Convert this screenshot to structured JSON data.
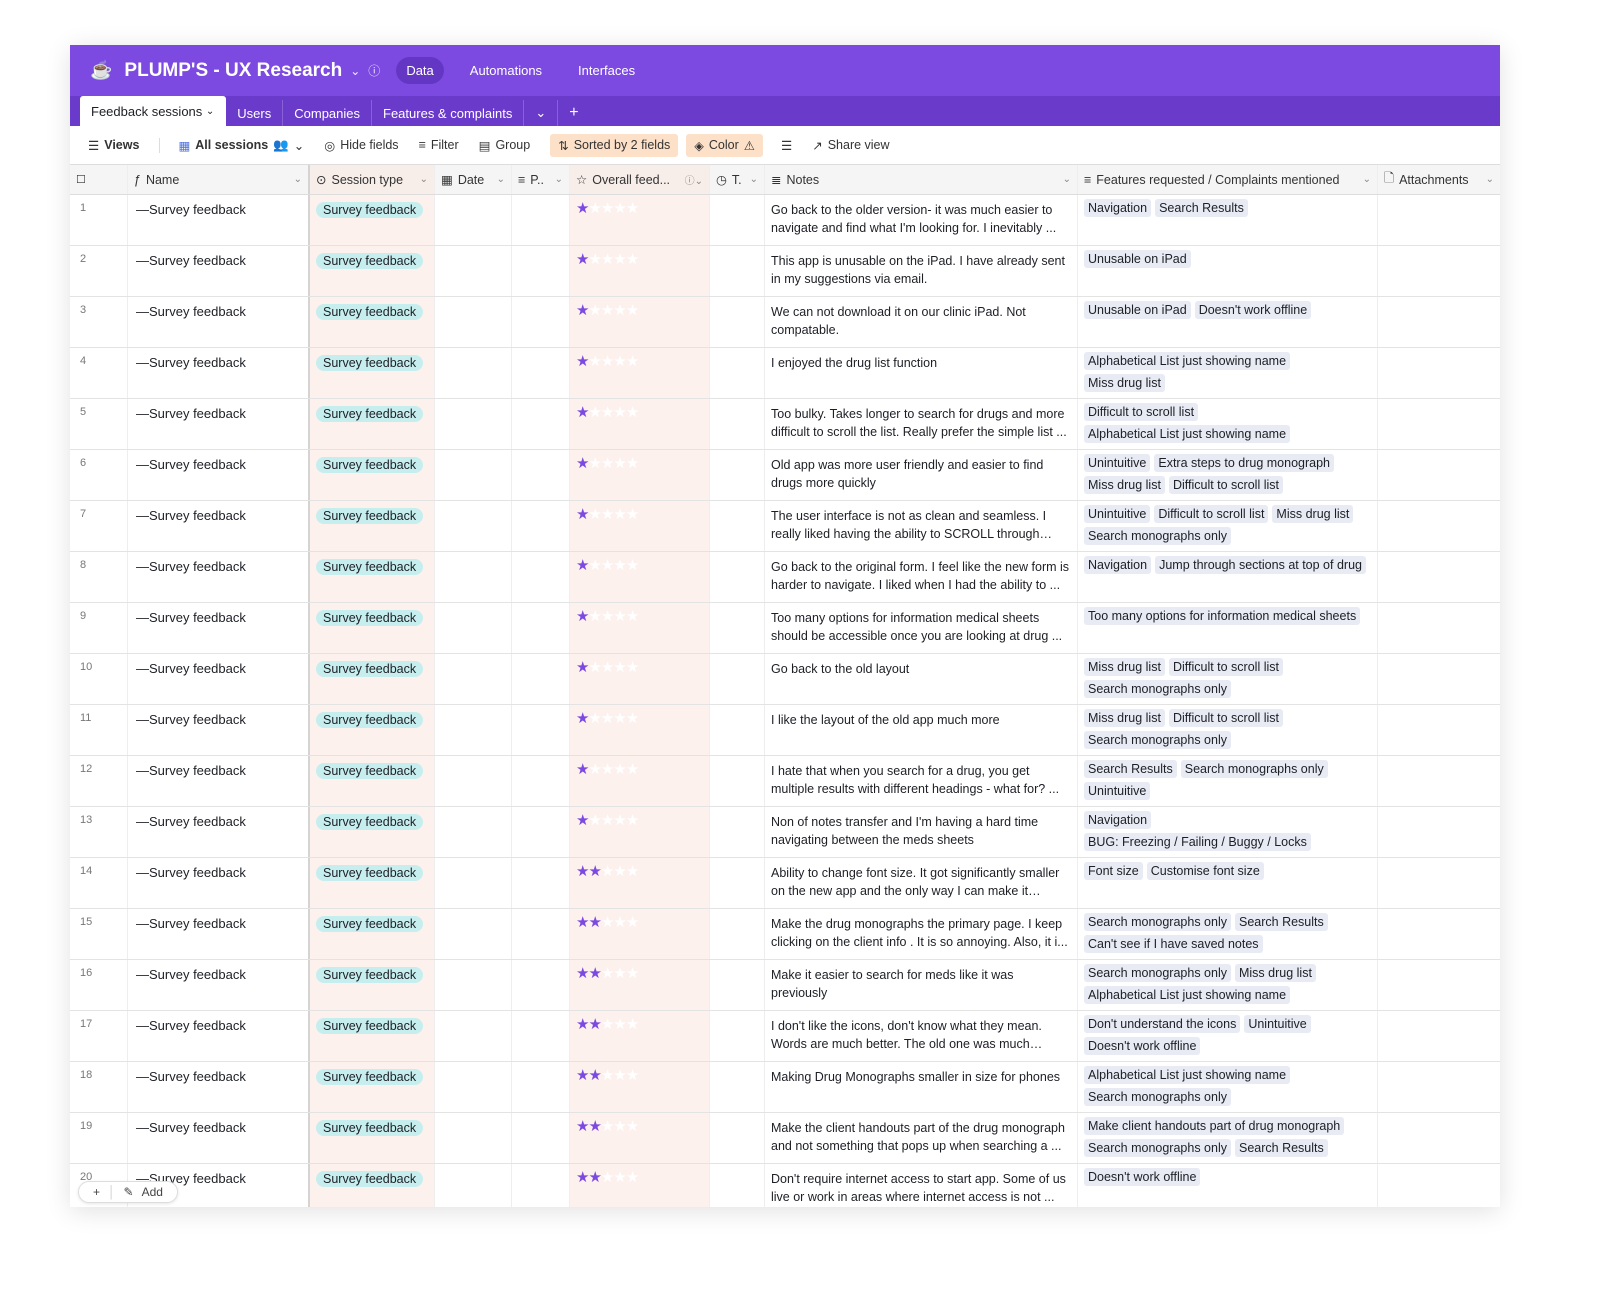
{
  "header": {
    "title": "PLUMP'S - UX Research",
    "nav": [
      "Data",
      "Automations",
      "Interfaces"
    ]
  },
  "tabs": [
    "Feedback sessions",
    "Users",
    "Companies",
    "Features & complaints"
  ],
  "toolbar": {
    "views": "Views",
    "view_name": "All sessions",
    "hide": "Hide fields",
    "filter": "Filter",
    "group": "Group",
    "sort": "Sorted by 2 fields",
    "color": "Color",
    "share": "Share view"
  },
  "columns": [
    "Name",
    "Session type",
    "Date",
    "P..",
    "Overall feed...",
    "T.",
    "Notes",
    "Features requested / Complaints mentioned",
    "Attachments"
  ],
  "footer": {
    "add": "Add"
  },
  "colors": {
    "accent": "#7c4ae0",
    "session_pill": "#c7eeee",
    "tag": "#e8ebf4"
  },
  "rows": [
    {
      "n": "1",
      "name": "—Survey feedback",
      "type": "Survey feedback",
      "rating": 1,
      "notes": "Go back to the older version- it was much easier to navigate and find what I'm looking for. I inevitably ...",
      "tags": [
        "Navigation",
        "Search Results"
      ]
    },
    {
      "n": "2",
      "name": "—Survey feedback",
      "type": "Survey feedback",
      "rating": 1,
      "notes": "This app is unusable on the iPad. I have already sent in my suggestions via email.",
      "tags": [
        "Unusable on iPad"
      ]
    },
    {
      "n": "3",
      "name": "—Survey feedback",
      "type": "Survey feedback",
      "rating": 1,
      "notes": "We can not download it on our clinic iPad. Not compatable.",
      "tags": [
        "Unusable on iPad",
        "Doesn't work offline"
      ]
    },
    {
      "n": "4",
      "name": "—Survey feedback",
      "type": "Survey feedback",
      "rating": 1,
      "notes": "I enjoyed the drug list function",
      "tags": [
        "Alphabetical List just showing name",
        "Miss drug list"
      ]
    },
    {
      "n": "5",
      "name": "—Survey feedback",
      "type": "Survey feedback",
      "rating": 1,
      "notes": "Too bulky. Takes longer to search for drugs and more difficult to scroll the list. Really prefer the simple list ...",
      "tags": [
        "Difficult to scroll list",
        "Alphabetical List just showing name"
      ]
    },
    {
      "n": "6",
      "name": "—Survey feedback",
      "type": "Survey feedback",
      "rating": 1,
      "notes": "Old app was more user friendly and easier to find drugs more quickly",
      "tags": [
        "Unintuitive",
        "Extra steps to drug monograph",
        "Miss drug list",
        "Difficult to scroll list"
      ]
    },
    {
      "n": "7",
      "name": "—Survey feedback",
      "type": "Survey feedback",
      "rating": 1,
      "notes": "The user interface is not as clean and seamless. I really liked having the ability to SCROLL through ALL...",
      "tags": [
        "Unintuitive",
        "Difficult to scroll list",
        "Miss drug list",
        "Search monographs only"
      ]
    },
    {
      "n": "8",
      "name": "—Survey feedback",
      "type": "Survey feedback",
      "rating": 1,
      "notes": "Go back to the original form. I feel like the new form is harder to navigate. I liked when I had the ability to ...",
      "tags": [
        "Navigation",
        "Jump through sections at top of drug"
      ]
    },
    {
      "n": "9",
      "name": "—Survey feedback",
      "type": "Survey feedback",
      "rating": 1,
      "notes": "Too many options for information medical sheets should be accessible once you are looking at drug ...",
      "tags": [
        "Too many options for information medical sheets"
      ]
    },
    {
      "n": "10",
      "name": "—Survey feedback",
      "type": "Survey feedback",
      "rating": 1,
      "notes": "Go back to the old layout",
      "tags": [
        "Miss drug list",
        "Difficult to scroll list",
        "Search monographs only"
      ]
    },
    {
      "n": "11",
      "name": "—Survey feedback",
      "type": "Survey feedback",
      "rating": 1,
      "notes": "I like the layout of the old app much more",
      "tags": [
        "Miss drug list",
        "Difficult to scroll list",
        "Search monographs only"
      ]
    },
    {
      "n": "12",
      "name": "—Survey feedback",
      "type": "Survey feedback",
      "rating": 1,
      "notes": "I hate that when you search for a drug, you get multiple results with different headings - what for? ...",
      "tags": [
        "Search Results",
        "Search monographs only",
        "Unintuitive"
      ]
    },
    {
      "n": "13",
      "name": "—Survey feedback",
      "type": "Survey feedback",
      "rating": 1,
      "notes": "Non of notes transfer and I'm having a hard time navigating between the meds sheets",
      "tags": [
        "Navigation",
        "BUG: Freezing / Failing / Buggy / Locks"
      ]
    },
    {
      "n": "14",
      "name": "—Survey feedback",
      "type": "Survey feedback",
      "rating": 2,
      "notes": "Ability to change font size. It got significantly smaller on the new app and the only way I can make it bigge...",
      "tags": [
        "Font size",
        "Customise font size"
      ]
    },
    {
      "n": "15",
      "name": "—Survey feedback",
      "type": "Survey feedback",
      "rating": 2,
      "notes": "Make the drug monographs the primary page. I keep clicking on the client info . It is so annoying. Also, it i...",
      "tags": [
        "Search monographs only",
        "Search Results",
        "Can't see if I have saved notes"
      ]
    },
    {
      "n": "16",
      "name": "—Survey feedback",
      "type": "Survey feedback",
      "rating": 2,
      "notes": "Make it easier to search for meds like it was previously",
      "tags": [
        "Search monographs only",
        "Miss drug list",
        "Alphabetical List just showing name"
      ]
    },
    {
      "n": "17",
      "name": "—Survey feedback",
      "type": "Survey feedback",
      "rating": 2,
      "notes": "I don't like the icons, don't know what they mean. Words are much better. The old one was much easie...",
      "tags": [
        "Don't understand the icons",
        "Unintuitive",
        "Doesn't work offline"
      ]
    },
    {
      "n": "18",
      "name": "—Survey feedback",
      "type": "Survey feedback",
      "rating": 2,
      "notes": "Making Drug Monographs smaller in size for phones",
      "tags": [
        "Alphabetical List just showing name",
        "Search monographs only"
      ]
    },
    {
      "n": "19",
      "name": "—Survey feedback",
      "type": "Survey feedback",
      "rating": 2,
      "notes": "Make the client handouts part of the drug monograph and not something that pops up when searching a ...",
      "tags": [
        "Make client handouts part of drug monograph",
        "Search monographs only",
        "Search Results"
      ]
    },
    {
      "n": "20",
      "name": "—Survey feedback",
      "type": "Survey feedback",
      "rating": 2,
      "notes": "Don't require internet access to start app. Some of us live or work in areas where internet access is not ...",
      "tags": [
        "Doesn't work offline"
      ]
    }
  ]
}
